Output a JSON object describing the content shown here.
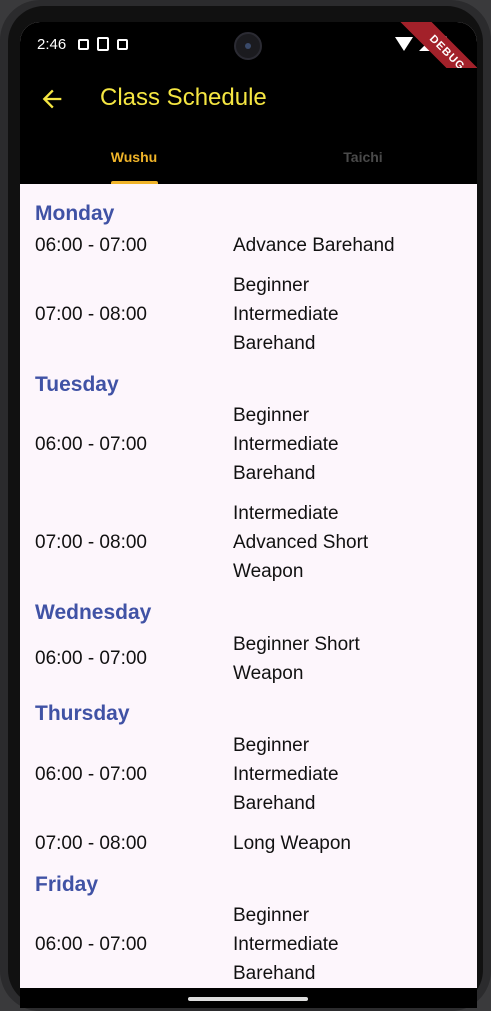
{
  "status_bar": {
    "time": "2:46"
  },
  "debug_label": "DEBUG",
  "app_bar": {
    "back_icon": "arrow-left-icon",
    "title": "Class Schedule"
  },
  "tabs": [
    {
      "label": "Wushu",
      "active": true
    },
    {
      "label": "Taichi",
      "active": false
    }
  ],
  "colors": {
    "accent": "#f0b429",
    "title": "#f5e642",
    "day_heading": "#4052a5"
  },
  "schedule": {
    "monday": {
      "day": "Monday",
      "slots": [
        {
          "time": "06:00 - 07:00",
          "classes": "Advance Barehand"
        },
        {
          "time": "07:00 - 08:00",
          "lines": [
            "Beginner",
            "Intermediate",
            "Barehand"
          ]
        }
      ]
    },
    "tuesday": {
      "day": "Tuesday",
      "slots": [
        {
          "time": "06:00 - 07:00",
          "lines": [
            "Beginner",
            "Intermediate",
            "Barehand"
          ]
        },
        {
          "time": "07:00 - 08:00",
          "lines": [
            "Intermediate",
            "Advanced Short",
            "Weapon"
          ]
        }
      ]
    },
    "wednesday": {
      "day": "Wednesday",
      "slots": [
        {
          "time": "06:00 - 07:00",
          "lines": [
            "Beginner Short",
            "Weapon"
          ]
        }
      ]
    },
    "thursday": {
      "day": "Thursday",
      "slots": [
        {
          "time": "06:00 - 07:00",
          "lines": [
            "Beginner",
            "Intermediate",
            "Barehand"
          ]
        },
        {
          "time": "07:00 - 08:00",
          "classes": "Long Weapon"
        }
      ]
    },
    "friday": {
      "day": "Friday",
      "slots": [
        {
          "time": "06:00 - 07:00",
          "lines": [
            "Beginner",
            "Intermediate",
            "Barehand"
          ]
        }
      ]
    }
  }
}
